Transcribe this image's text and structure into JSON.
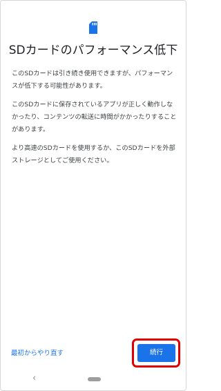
{
  "icon": {
    "name": "sd-card-icon",
    "color": "#1a73e8"
  },
  "title": "SDカードのパフォーマンス低下",
  "paragraphs": [
    "このSDカードは引き続き使用できますが、パフォーマン\nスが低下する可能性があります。",
    "このSDカードに保存されているアプリが正しく動作しな\nかったり、コンテンツの転送に時間がかかったりすること\nがあります。",
    "より高速のSDカードを使用するか、このSDカードを外部\nストレージとしてご使用ください。"
  ],
  "actions": {
    "restart_label": "最初からやり直す",
    "continue_label": "続行"
  },
  "navbar": {
    "back_icon": "back-chevron-icon",
    "home_icon": "home-pill-icon"
  },
  "colors": {
    "accent": "#1a73e8",
    "highlight": "#e00000",
    "text": "#202124"
  }
}
